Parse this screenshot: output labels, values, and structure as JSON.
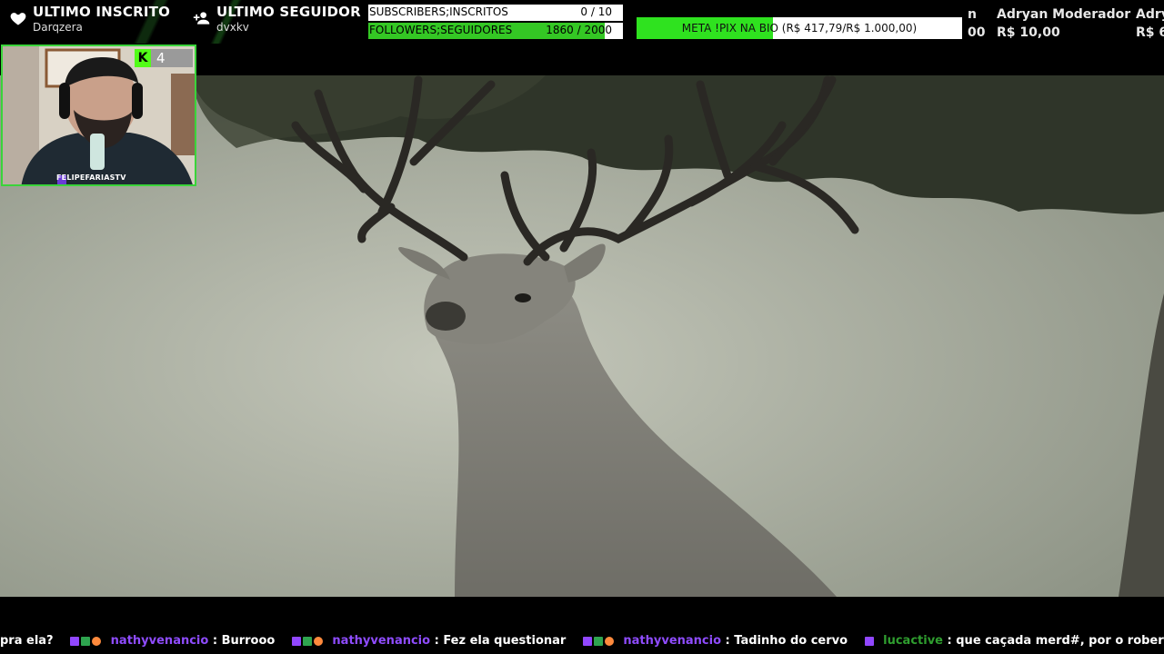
{
  "latest_sub": {
    "title": "ULTIMO INSCRITO",
    "name": "Darqzera",
    "icon": "heart-icon"
  },
  "latest_follower": {
    "title": "ULTIMO SEGUIDOR",
    "name": "dvxkv",
    "icon": "user-plus-icon"
  },
  "goals": [
    {
      "label": "SUBSCRIBERS;INSCRITOS",
      "count": "0 / 10",
      "progress": 0
    },
    {
      "label": "FOLLOWERS;SEGUIDORES",
      "count": "1860 / 2000",
      "progress": 0.93
    }
  ],
  "pix_goal": {
    "label": "META !PIX NA BIO (R$ 417,79/R$ 1.000,00)",
    "progress": 0.42
  },
  "donors": [
    {
      "name": "n",
      "amount": "00"
    },
    {
      "name": "Adryan Moderador",
      "amount": "R$ 10,00"
    },
    {
      "name": "Adry",
      "amount": "R$ 6"
    }
  ],
  "webcam": {
    "kick_count": "4",
    "kick_letter": "K",
    "channel_tag": "FELIPEFARIASTV"
  },
  "chat": [
    {
      "user": "",
      "text": "pra ela?",
      "badges": false
    },
    {
      "user": "nathyvenancio",
      "text": ": Burrooo",
      "badges": true,
      "color": "nathy"
    },
    {
      "user": "nathyvenancio",
      "text": ": Fez ela questionar",
      "badges": true,
      "color": "nathy"
    },
    {
      "user": "nathyvenancio",
      "text": ": Tadinho do cervo",
      "badges": true,
      "color": "nathy"
    },
    {
      "user": "lucactive",
      "text": ": que caçada merd#, por o robert matava bêbado sozinho",
      "badges": true,
      "color": "luc"
    }
  ],
  "colors": {
    "accent": "#34c724",
    "kick": "#53fc18",
    "cam_border": "#3ad43a",
    "chat_user": "#8f4cff",
    "chat_user_alt": "#2f9e2f"
  }
}
